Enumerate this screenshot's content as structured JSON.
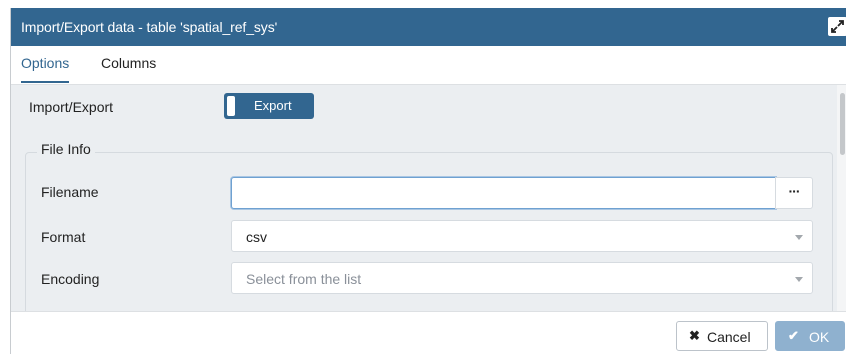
{
  "dialog": {
    "title": "Import/Export data - table 'spatial_ref_sys'",
    "expand_icon": "expand-arrows-icon"
  },
  "tabs": [
    {
      "label": "Options",
      "active": true
    },
    {
      "label": "Columns",
      "active": false
    }
  ],
  "options": {
    "import_export_label": "Import/Export",
    "toggle_value": "Export",
    "file_info": {
      "legend": "File Info",
      "filename": {
        "label": "Filename",
        "value": "",
        "browse_label": "···"
      },
      "format": {
        "label": "Format",
        "value": "csv"
      },
      "encoding": {
        "label": "Encoding",
        "placeholder": "Select from the list"
      }
    }
  },
  "footer": {
    "cancel": {
      "icon": "✖",
      "label": "Cancel"
    },
    "ok": {
      "icon": "✔",
      "label": "OK"
    }
  },
  "colors": {
    "titlebar": "#326690",
    "accent": "#326690",
    "content_bg": "#ebeef1",
    "ok_disabled": "#8fb1cf"
  }
}
